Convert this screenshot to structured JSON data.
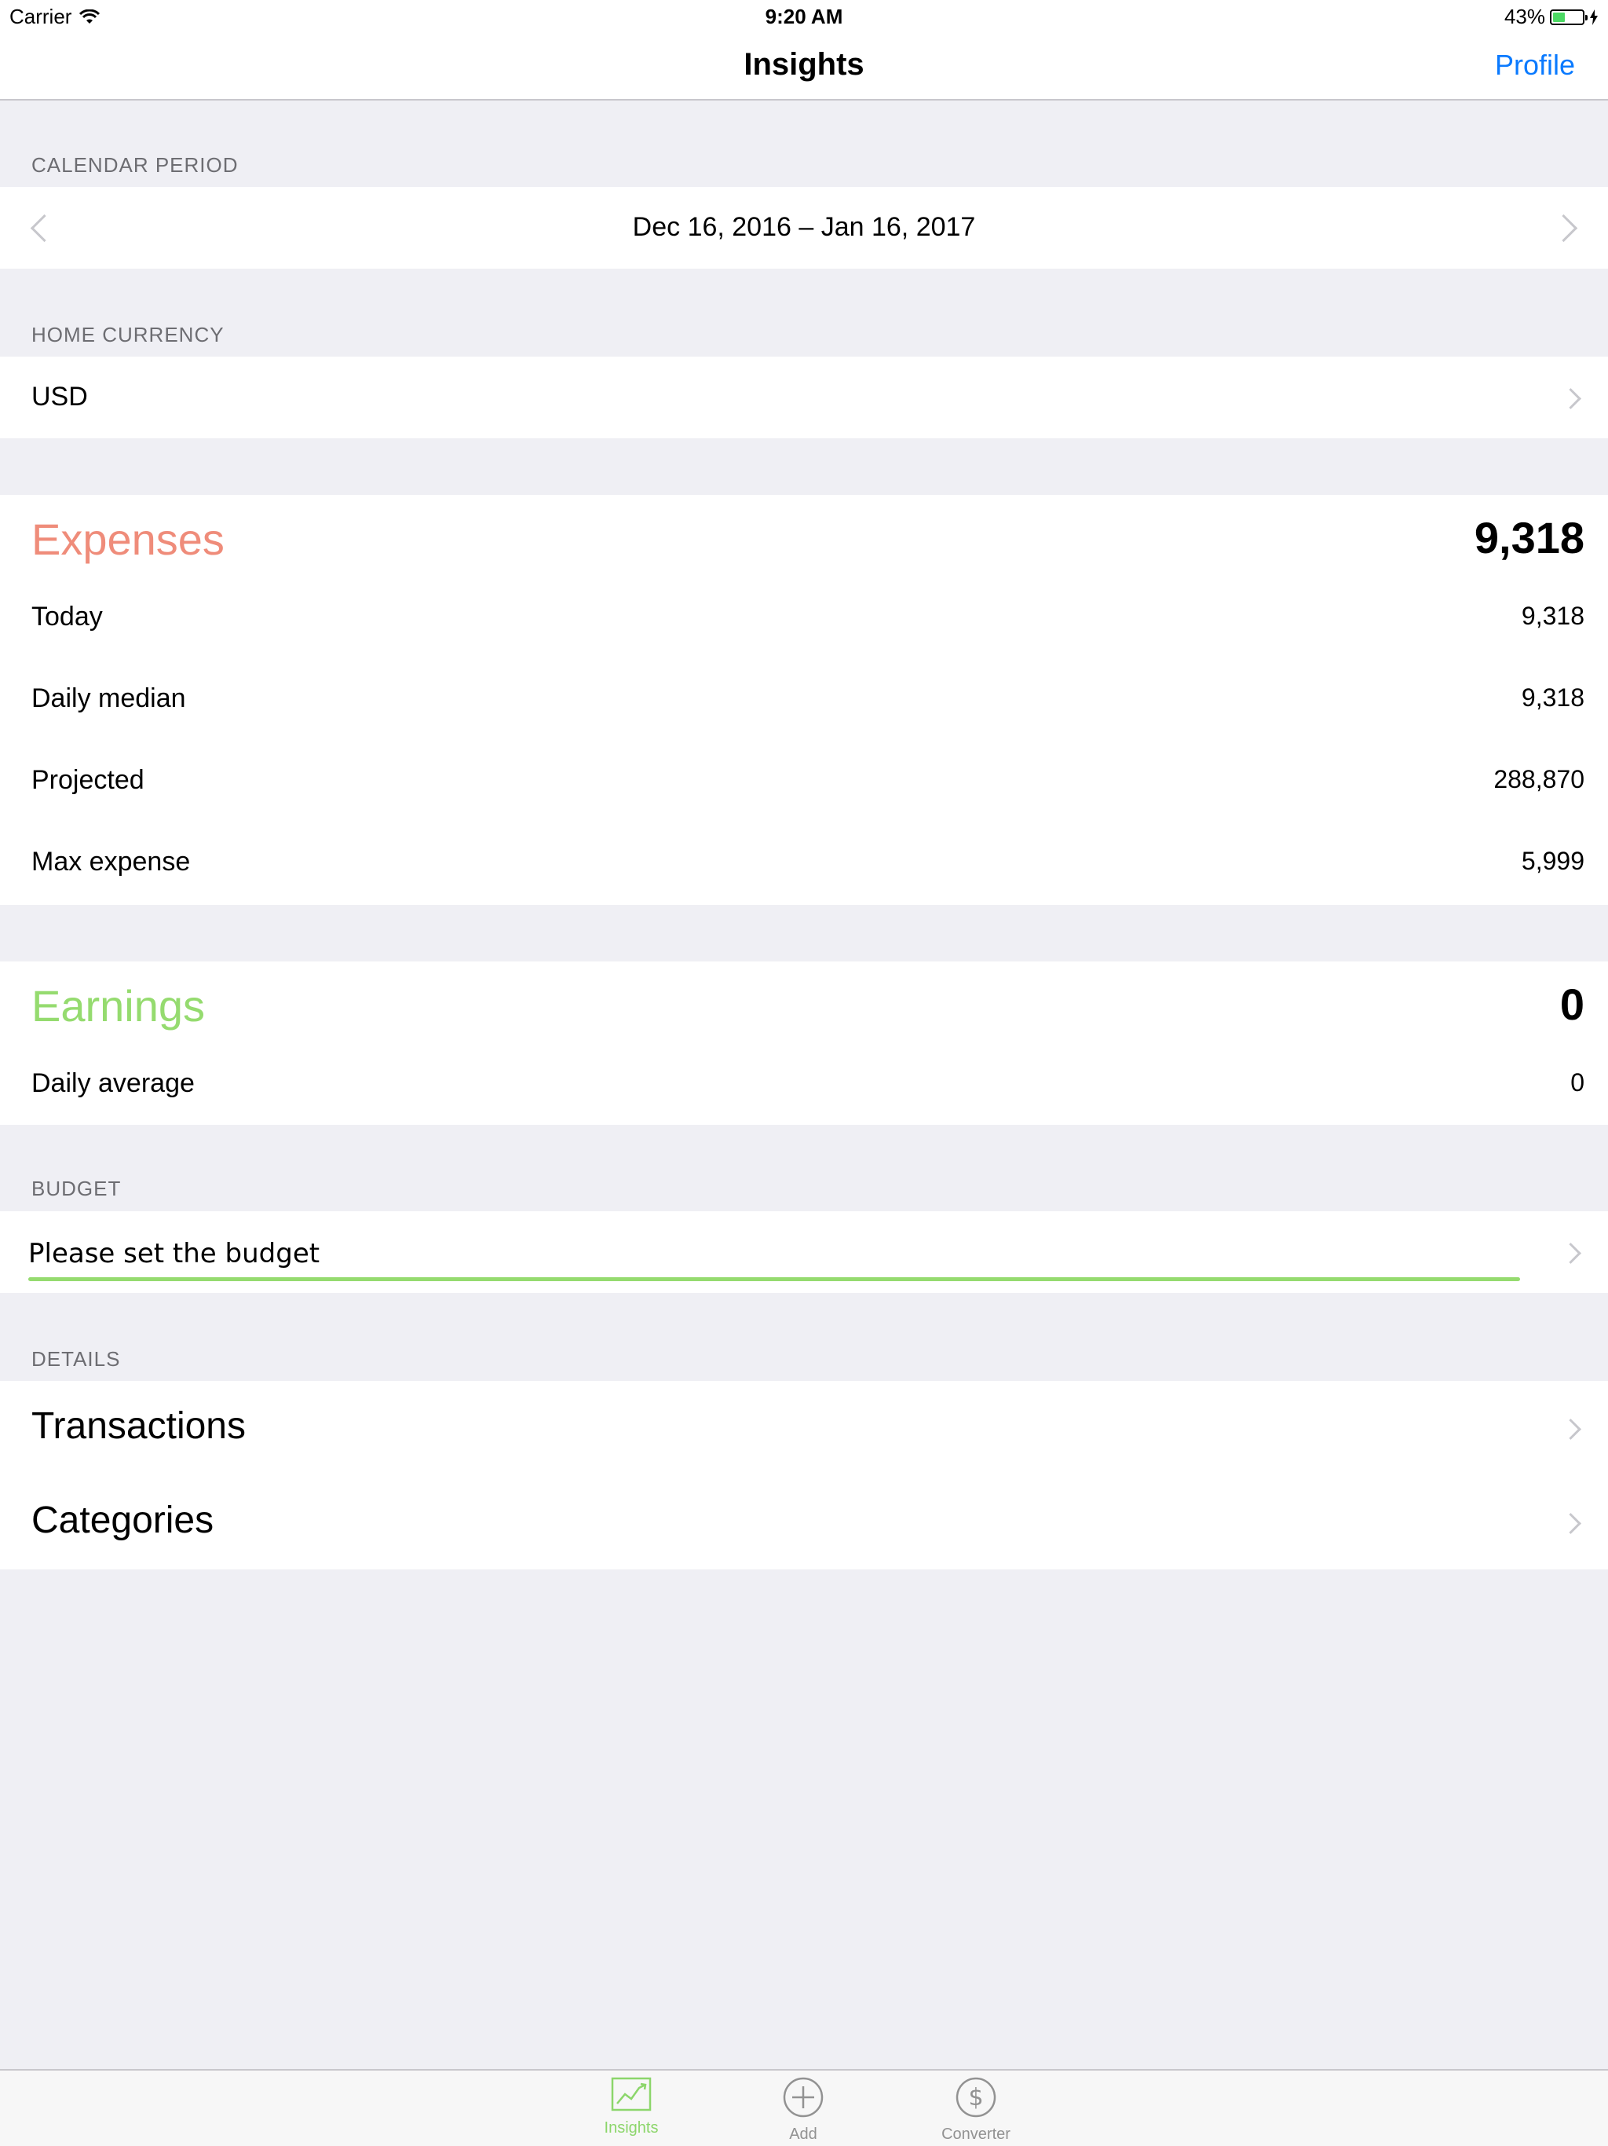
{
  "status_bar": {
    "carrier": "Carrier",
    "time": "9:20 AM",
    "battery_percent": "43%",
    "battery_level": 0.43
  },
  "nav": {
    "title": "Insights",
    "profile_label": "Profile"
  },
  "calendar_period": {
    "header": "CALENDAR PERIOD",
    "range": "Dec 16, 2016 – Jan 16, 2017"
  },
  "home_currency": {
    "header": "HOME CURRENCY",
    "value": "USD"
  },
  "expenses": {
    "title": "Expenses",
    "total": "9,318",
    "color": "#ef8c7a",
    "rows": [
      {
        "label": "Today",
        "value": "9,318"
      },
      {
        "label": "Daily median",
        "value": "9,318"
      },
      {
        "label": "Projected",
        "value": "288,870"
      },
      {
        "label": "Max expense",
        "value": "5,999"
      }
    ]
  },
  "earnings": {
    "title": "Earnings",
    "total": "0",
    "color": "#95db6f",
    "rows": [
      {
        "label": "Daily average",
        "value": "0"
      }
    ]
  },
  "budget": {
    "header": "BUDGET",
    "prompt": "Please set the budget",
    "progress_color": "#95db6f"
  },
  "details": {
    "header": "DETAILS",
    "items": [
      {
        "label": "Transactions"
      },
      {
        "label": "Categories"
      }
    ]
  },
  "tabs": [
    {
      "label": "Insights",
      "icon": "chart-icon",
      "active": true
    },
    {
      "label": "Add",
      "icon": "plus-circle-icon",
      "active": false
    },
    {
      "label": "Converter",
      "icon": "dollar-circle-icon",
      "active": false
    }
  ],
  "colors": {
    "accent_blue": "#0a7aff",
    "active_tab": "#8cd66b",
    "background": "#efeff4"
  }
}
